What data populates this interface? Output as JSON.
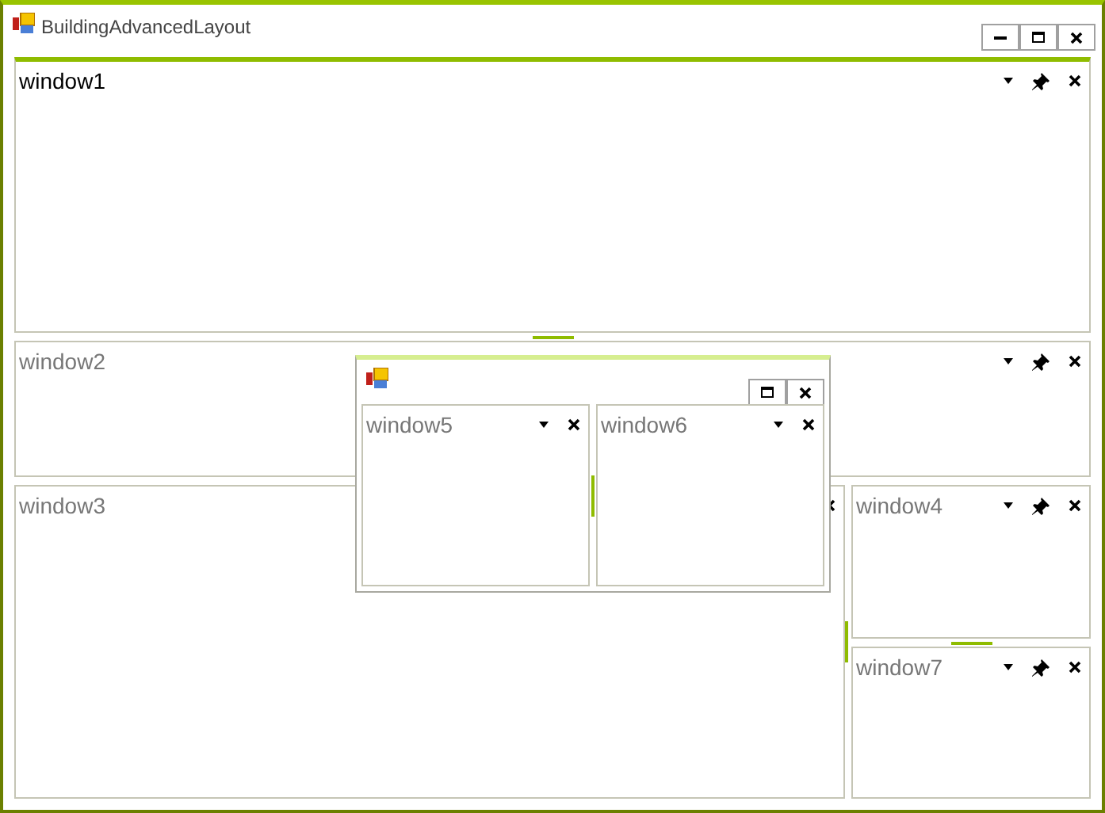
{
  "window": {
    "title": "BuildingAdvancedLayout"
  },
  "panes": [
    {
      "title": "window1",
      "selected": true
    },
    {
      "title": "window2",
      "selected": false
    },
    {
      "title": "window3",
      "selected": false
    },
    {
      "title": "window4",
      "selected": false
    },
    {
      "title": "window7",
      "selected": false
    }
  ],
  "floating_window": {
    "panes": [
      {
        "title": "window5",
        "selected": false
      },
      {
        "title": "window6",
        "selected": false
      }
    ]
  }
}
